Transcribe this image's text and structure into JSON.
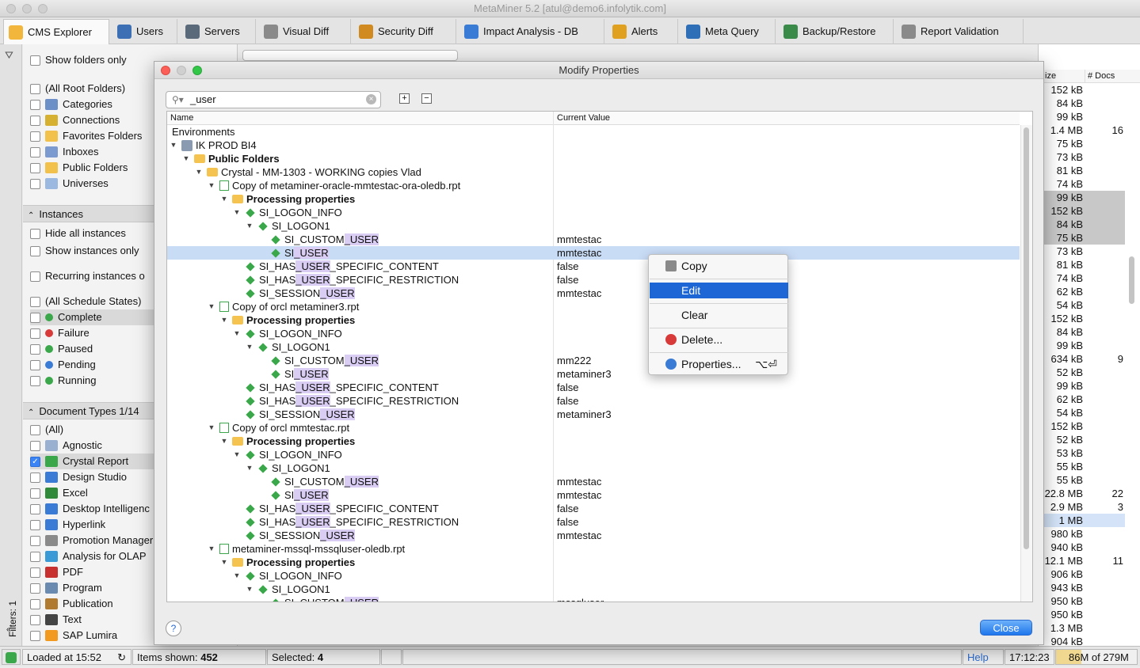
{
  "window": {
    "title": "MetaMiner 5.2 [atul@demo6.infolytik.com]"
  },
  "tabs": [
    {
      "label": "CMS Explorer",
      "icon": "folder-icon",
      "color": "#f2b63d"
    },
    {
      "label": "Users",
      "icon": "users-icon",
      "color": "#3d6fb5"
    },
    {
      "label": "Servers",
      "icon": "servers-icon",
      "color": "#5a6a7a"
    },
    {
      "label": "Visual Diff",
      "icon": "document-compare-icon",
      "color": "#8a8a8a"
    },
    {
      "label": "Security Diff",
      "icon": "key-icon",
      "color": "#d08a20"
    },
    {
      "label": "Impact Analysis - DB",
      "icon": "database-icon",
      "color": "#3a7bd5"
    },
    {
      "label": "Alerts",
      "icon": "bell-icon",
      "color": "#e0a020"
    },
    {
      "label": "Meta Query",
      "icon": "sql-icon",
      "color": "#2f6fb8"
    },
    {
      "label": "Backup/Restore",
      "icon": "restore-icon",
      "color": "#3a8a4a"
    },
    {
      "label": "Report Validation",
      "icon": "report-check-icon",
      "color": "#8a8a8a"
    }
  ],
  "sidebar": {
    "show_folders_only": "Show folders only",
    "folder_filters": [
      {
        "label": "(All Root Folders)",
        "icon": ""
      },
      {
        "label": "Categories",
        "icon": "categories-icon",
        "color": "#6d8fc7"
      },
      {
        "label": "Connections",
        "icon": "connections-icon",
        "color": "#d6b030"
      },
      {
        "label": "Favorites Folders",
        "icon": "favorites-icon",
        "color": "#f2c14b"
      },
      {
        "label": "Inboxes",
        "icon": "inbox-icon",
        "color": "#7a9ad0"
      },
      {
        "label": "Public Folders",
        "icon": "folder-icon",
        "color": "#f2c14b"
      },
      {
        "label": "Universes",
        "icon": "universe-icon",
        "color": "#9ab8e0"
      }
    ],
    "instances_header": "Instances",
    "hide_all_instances": "Hide all instances",
    "show_instances_only": "Show instances only",
    "recurring_instances": "Recurring instances o",
    "schedule_states": [
      {
        "label": "(All Schedule States)",
        "icon": ""
      },
      {
        "label": "Complete",
        "icon": "complete-icon",
        "color": "#3aa84a"
      },
      {
        "label": "Failure",
        "icon": "failure-icon",
        "color": "#d83a3a"
      },
      {
        "label": "Paused",
        "icon": "paused-icon",
        "color": "#3aa84a"
      },
      {
        "label": "Pending",
        "icon": "pending-icon",
        "color": "#3a7bd5"
      },
      {
        "label": "Running",
        "icon": "running-icon",
        "color": "#3aa84a"
      }
    ],
    "doctypes_header": "Document Types 1/14",
    "doc_types": [
      {
        "label": "(All)",
        "icon": "",
        "checked": false
      },
      {
        "label": "Agnostic",
        "icon": "document-icon",
        "color": "#9ab0d0",
        "checked": false
      },
      {
        "label": "Crystal Report",
        "icon": "crystal-report-icon",
        "color": "#3aa84a",
        "checked": true
      },
      {
        "label": "Design Studio",
        "icon": "design-studio-icon",
        "color": "#3a7bd5",
        "checked": false
      },
      {
        "label": "Excel",
        "icon": "excel-icon",
        "color": "#2f8a3a",
        "checked": false
      },
      {
        "label": "Desktop Intelligenc",
        "icon": "desktop-intelligence-icon",
        "color": "#3a7bd5",
        "checked": false
      },
      {
        "label": "Hyperlink",
        "icon": "hyperlink-icon",
        "color": "#3a7bd5",
        "checked": false
      },
      {
        "label": "Promotion Manager",
        "icon": "promotion-icon",
        "color": "#8a8a8a",
        "checked": false
      },
      {
        "label": "Analysis for OLAP",
        "icon": "olap-icon",
        "color": "#3a9ad5",
        "checked": false
      },
      {
        "label": "PDF",
        "icon": "pdf-icon",
        "color": "#c83030",
        "checked": false
      },
      {
        "label": "Program",
        "icon": "program-icon",
        "color": "#6a8ab0",
        "checked": false
      },
      {
        "label": "Publication",
        "icon": "publication-icon",
        "color": "#b07a30",
        "checked": false
      },
      {
        "label": "Text",
        "icon": "text-icon",
        "color": "#444444",
        "checked": false
      },
      {
        "label": "SAP Lumira",
        "icon": "lumira-icon",
        "color": "#f29a20",
        "checked": false
      }
    ],
    "filters_label": "Filters: 1"
  },
  "right_table": {
    "headers": {
      "size": "ize",
      "docs": "# Docs"
    },
    "rows": [
      {
        "size": "152 kB",
        "docs": "",
        "hl": ""
      },
      {
        "size": "84 kB",
        "docs": "",
        "hl": ""
      },
      {
        "size": "99 kB",
        "docs": "",
        "hl": ""
      },
      {
        "size": "1.4 MB",
        "docs": "16",
        "hl": ""
      },
      {
        "size": "75 kB",
        "docs": "",
        "hl": ""
      },
      {
        "size": "73 kB",
        "docs": "",
        "hl": ""
      },
      {
        "size": "81 kB",
        "docs": "",
        "hl": ""
      },
      {
        "size": "74 kB",
        "docs": "",
        "hl": ""
      },
      {
        "size": "99 kB",
        "docs": "",
        "hl": "gray"
      },
      {
        "size": "152 kB",
        "docs": "",
        "hl": "gray"
      },
      {
        "size": "84 kB",
        "docs": "",
        "hl": "gray"
      },
      {
        "size": "75 kB",
        "docs": "",
        "hl": "gray"
      },
      {
        "size": "73 kB",
        "docs": "",
        "hl": ""
      },
      {
        "size": "81 kB",
        "docs": "",
        "hl": ""
      },
      {
        "size": "74 kB",
        "docs": "",
        "hl": ""
      },
      {
        "size": "62 kB",
        "docs": "",
        "hl": ""
      },
      {
        "size": "54 kB",
        "docs": "",
        "hl": ""
      },
      {
        "size": "152 kB",
        "docs": "",
        "hl": ""
      },
      {
        "size": "84 kB",
        "docs": "",
        "hl": ""
      },
      {
        "size": "99 kB",
        "docs": "",
        "hl": ""
      },
      {
        "size": "634 kB",
        "docs": "9",
        "hl": ""
      },
      {
        "size": "52 kB",
        "docs": "",
        "hl": ""
      },
      {
        "size": "99 kB",
        "docs": "",
        "hl": ""
      },
      {
        "size": "62 kB",
        "docs": "",
        "hl": ""
      },
      {
        "size": "54 kB",
        "docs": "",
        "hl": ""
      },
      {
        "size": "152 kB",
        "docs": "",
        "hl": ""
      },
      {
        "size": "52 kB",
        "docs": "",
        "hl": ""
      },
      {
        "size": "53 kB",
        "docs": "",
        "hl": ""
      },
      {
        "size": "55 kB",
        "docs": "",
        "hl": ""
      },
      {
        "size": "55 kB",
        "docs": "",
        "hl": ""
      },
      {
        "size": "22.8 MB",
        "docs": "22",
        "hl": ""
      },
      {
        "size": "2.9 MB",
        "docs": "3",
        "hl": ""
      },
      {
        "size": "1 MB",
        "docs": "",
        "hl": "blue"
      },
      {
        "size": "980 kB",
        "docs": "",
        "hl": ""
      },
      {
        "size": "940 kB",
        "docs": "",
        "hl": ""
      },
      {
        "size": "12.1 MB",
        "docs": "11",
        "hl": ""
      },
      {
        "size": "906 kB",
        "docs": "",
        "hl": ""
      },
      {
        "size": "943 kB",
        "docs": "",
        "hl": ""
      },
      {
        "size": "950 kB",
        "docs": "",
        "hl": ""
      },
      {
        "size": "950 kB",
        "docs": "",
        "hl": ""
      },
      {
        "size": "1.3 MB",
        "docs": "",
        "hl": ""
      },
      {
        "size": "904 kB",
        "docs": "",
        "hl": ""
      }
    ]
  },
  "dialog": {
    "title": "Modify Properties",
    "search_value": "_user",
    "columns": {
      "name": "Name",
      "value": "Current Value"
    },
    "rows": [
      {
        "indent": 0,
        "arrow": "",
        "icon": "",
        "pre": "Environments",
        "hl": "",
        "post": "",
        "value": "",
        "bold": false,
        "sel": false
      },
      {
        "indent": 0,
        "arrow": "down",
        "icon": "server-icon",
        "pre": "IK PROD BI4",
        "hl": "",
        "post": "",
        "value": "",
        "bold": false,
        "sel": false
      },
      {
        "indent": 1,
        "arrow": "down",
        "icon": "folder-icon",
        "pre": "Public Folders",
        "hl": "",
        "post": "",
        "value": "",
        "bold": true,
        "sel": false
      },
      {
        "indent": 2,
        "arrow": "down",
        "icon": "folder-icon",
        "pre": "Crystal - MM-1303 - WORKING copies Vlad",
        "hl": "",
        "post": "",
        "value": "",
        "bold": false,
        "sel": false
      },
      {
        "indent": 3,
        "arrow": "down",
        "icon": "report-icon",
        "pre": "Copy of metaminer-oracle-mmtestac-ora-oledb.rpt",
        "hl": "",
        "post": "",
        "value": "",
        "bold": false,
        "sel": false
      },
      {
        "indent": 4,
        "arrow": "down",
        "icon": "folder-icon",
        "pre": "Processing properties",
        "hl": "",
        "post": "",
        "value": "",
        "bold": true,
        "sel": false
      },
      {
        "indent": 5,
        "arrow": "down",
        "icon": "property-icon",
        "pre": "SI_LOGON_INFO",
        "hl": "",
        "post": "",
        "value": "",
        "bold": false,
        "sel": false
      },
      {
        "indent": 6,
        "arrow": "down",
        "icon": "property-icon",
        "pre": "SI_LOGON1",
        "hl": "",
        "post": "",
        "value": "",
        "bold": false,
        "sel": false
      },
      {
        "indent": 7,
        "arrow": "",
        "icon": "property-icon",
        "pre": "SI_CUSTOM",
        "hl": "_USER",
        "post": "",
        "value": "mmtestac",
        "bold": false,
        "sel": false
      },
      {
        "indent": 7,
        "arrow": "",
        "icon": "property-icon",
        "pre": "SI",
        "hl": "_USER",
        "post": "",
        "value": "mmtestac",
        "bold": false,
        "sel": true
      },
      {
        "indent": 5,
        "arrow": "",
        "icon": "property-icon",
        "pre": "SI_HAS",
        "hl": "_USER",
        "post": "_SPECIFIC_CONTENT",
        "value": "false",
        "bold": false,
        "sel": false
      },
      {
        "indent": 5,
        "arrow": "",
        "icon": "property-icon",
        "pre": "SI_HAS",
        "hl": "_USER",
        "post": "_SPECIFIC_RESTRICTION",
        "value": "false",
        "bold": false,
        "sel": false
      },
      {
        "indent": 5,
        "arrow": "",
        "icon": "property-icon",
        "pre": "SI_SESSION",
        "hl": "_USER",
        "post": "",
        "value": "mmtestac",
        "bold": false,
        "sel": false
      },
      {
        "indent": 3,
        "arrow": "down",
        "icon": "report-icon",
        "pre": "Copy of orcl metaminer3.rpt",
        "hl": "",
        "post": "",
        "value": "",
        "bold": false,
        "sel": false
      },
      {
        "indent": 4,
        "arrow": "down",
        "icon": "folder-icon",
        "pre": "Processing properties",
        "hl": "",
        "post": "",
        "value": "",
        "bold": true,
        "sel": false
      },
      {
        "indent": 5,
        "arrow": "down",
        "icon": "property-icon",
        "pre": "SI_LOGON_INFO",
        "hl": "",
        "post": "",
        "value": "",
        "bold": false,
        "sel": false
      },
      {
        "indent": 6,
        "arrow": "down",
        "icon": "property-icon",
        "pre": "SI_LOGON1",
        "hl": "",
        "post": "",
        "value": "",
        "bold": false,
        "sel": false
      },
      {
        "indent": 7,
        "arrow": "",
        "icon": "property-icon",
        "pre": "SI_CUSTOM",
        "hl": "_USER",
        "post": "",
        "value": "mm222",
        "bold": false,
        "sel": false
      },
      {
        "indent": 7,
        "arrow": "",
        "icon": "property-icon",
        "pre": "SI",
        "hl": "_USER",
        "post": "",
        "value": "metaminer3",
        "bold": false,
        "sel": false
      },
      {
        "indent": 5,
        "arrow": "",
        "icon": "property-icon",
        "pre": "SI_HAS",
        "hl": "_USER",
        "post": "_SPECIFIC_CONTENT",
        "value": "false",
        "bold": false,
        "sel": false
      },
      {
        "indent": 5,
        "arrow": "",
        "icon": "property-icon",
        "pre": "SI_HAS",
        "hl": "_USER",
        "post": "_SPECIFIC_RESTRICTION",
        "value": "false",
        "bold": false,
        "sel": false
      },
      {
        "indent": 5,
        "arrow": "",
        "icon": "property-icon",
        "pre": "SI_SESSION",
        "hl": "_USER",
        "post": "",
        "value": "metaminer3",
        "bold": false,
        "sel": false
      },
      {
        "indent": 3,
        "arrow": "down",
        "icon": "report-icon",
        "pre": "Copy of orcl mmtestac.rpt",
        "hl": "",
        "post": "",
        "value": "",
        "bold": false,
        "sel": false
      },
      {
        "indent": 4,
        "arrow": "down",
        "icon": "folder-icon",
        "pre": "Processing properties",
        "hl": "",
        "post": "",
        "value": "",
        "bold": true,
        "sel": false
      },
      {
        "indent": 5,
        "arrow": "down",
        "icon": "property-icon",
        "pre": "SI_LOGON_INFO",
        "hl": "",
        "post": "",
        "value": "",
        "bold": false,
        "sel": false
      },
      {
        "indent": 6,
        "arrow": "down",
        "icon": "property-icon",
        "pre": "SI_LOGON1",
        "hl": "",
        "post": "",
        "value": "",
        "bold": false,
        "sel": false
      },
      {
        "indent": 7,
        "arrow": "",
        "icon": "property-icon",
        "pre": "SI_CUSTOM",
        "hl": "_USER",
        "post": "",
        "value": "mmtestac",
        "bold": false,
        "sel": false
      },
      {
        "indent": 7,
        "arrow": "",
        "icon": "property-icon",
        "pre": "SI",
        "hl": "_USER",
        "post": "",
        "value": "mmtestac",
        "bold": false,
        "sel": false
      },
      {
        "indent": 5,
        "arrow": "",
        "icon": "property-icon",
        "pre": "SI_HAS",
        "hl": "_USER",
        "post": "_SPECIFIC_CONTENT",
        "value": "false",
        "bold": false,
        "sel": false
      },
      {
        "indent": 5,
        "arrow": "",
        "icon": "property-icon",
        "pre": "SI_HAS",
        "hl": "_USER",
        "post": "_SPECIFIC_RESTRICTION",
        "value": "false",
        "bold": false,
        "sel": false
      },
      {
        "indent": 5,
        "arrow": "",
        "icon": "property-icon",
        "pre": "SI_SESSION",
        "hl": "_USER",
        "post": "",
        "value": "mmtestac",
        "bold": false,
        "sel": false
      },
      {
        "indent": 3,
        "arrow": "down",
        "icon": "report-icon",
        "pre": "metaminer-mssql-mssqluser-oledb.rpt",
        "hl": "",
        "post": "",
        "value": "",
        "bold": false,
        "sel": false
      },
      {
        "indent": 4,
        "arrow": "down",
        "icon": "folder-icon",
        "pre": "Processing properties",
        "hl": "",
        "post": "",
        "value": "",
        "bold": true,
        "sel": false
      },
      {
        "indent": 5,
        "arrow": "down",
        "icon": "property-icon",
        "pre": "SI_LOGON_INFO",
        "hl": "",
        "post": "",
        "value": "",
        "bold": false,
        "sel": false
      },
      {
        "indent": 6,
        "arrow": "down",
        "icon": "property-icon",
        "pre": "SI_LOGON1",
        "hl": "",
        "post": "",
        "value": "",
        "bold": false,
        "sel": false
      },
      {
        "indent": 7,
        "arrow": "",
        "icon": "property-icon",
        "pre": "SI_CUSTOM",
        "hl": "_USER",
        "post": "",
        "value": "mssqluser",
        "bold": false,
        "sel": false
      }
    ],
    "close_label": "Close",
    "help_label": "?"
  },
  "context_menu": {
    "items": [
      {
        "label": "Copy",
        "icon": "copy-icon",
        "color": "#8a8a8a",
        "shortcut": "",
        "highlighted": false
      },
      {
        "label": "Edit",
        "icon": "",
        "color": "",
        "shortcut": "",
        "highlighted": true
      },
      {
        "label": "Clear",
        "icon": "",
        "color": "",
        "shortcut": "",
        "highlighted": false
      },
      {
        "label": "Delete...",
        "icon": "delete-icon",
        "color": "#d83a3a",
        "shortcut": "",
        "highlighted": false
      },
      {
        "label": "Properties...",
        "icon": "info-icon",
        "color": "#3a7bd5",
        "shortcut": "⌥⏎",
        "highlighted": false
      }
    ]
  },
  "status_bar": {
    "loaded": "Loaded at 15:52",
    "items_shown_label": "Items shown:",
    "items_shown_value": "452",
    "selected_label": "Selected:",
    "selected_value": "4",
    "help": "Help",
    "time": "17:12:23",
    "memory": "86M of 279M",
    "memory_fraction": 0.31
  }
}
